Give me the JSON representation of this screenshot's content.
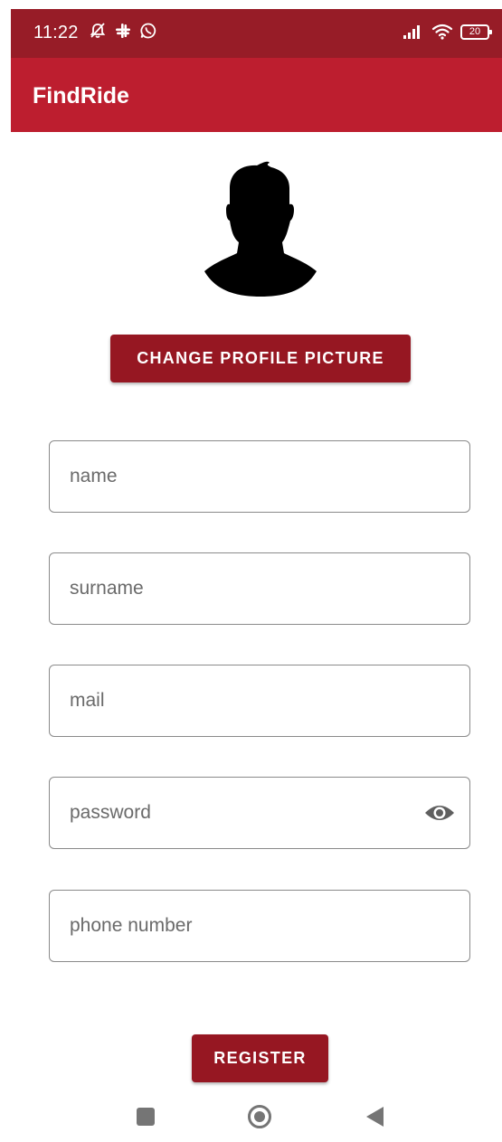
{
  "status_bar": {
    "time": "11:22",
    "notification_icons": [
      "muted-icon",
      "slack-icon",
      "whatsapp-icon"
    ],
    "signal_icon": "signal-icon",
    "wifi_icon": "wifi-icon",
    "battery": "20",
    "color": "#971c27"
  },
  "app_bar": {
    "title": "FindRide",
    "color": "#bd1e2f"
  },
  "profile": {
    "avatar_icon": "person-silhouette-icon",
    "change_picture_label": "CHANGE PROFILE PICTURE"
  },
  "form": {
    "name": {
      "placeholder": "name",
      "value": ""
    },
    "surname": {
      "placeholder": "surname",
      "value": ""
    },
    "mail": {
      "placeholder": "mail",
      "value": ""
    },
    "password": {
      "placeholder": "password",
      "value": "",
      "toggle_icon": "eye-icon"
    },
    "phone": {
      "placeholder": "phone number",
      "value": ""
    }
  },
  "register": {
    "label": "REGISTER",
    "color": "#961722"
  },
  "nav_bar": {
    "recents_icon": "square-icon",
    "home_icon": "circle-icon",
    "back_icon": "triangle-back-icon"
  }
}
